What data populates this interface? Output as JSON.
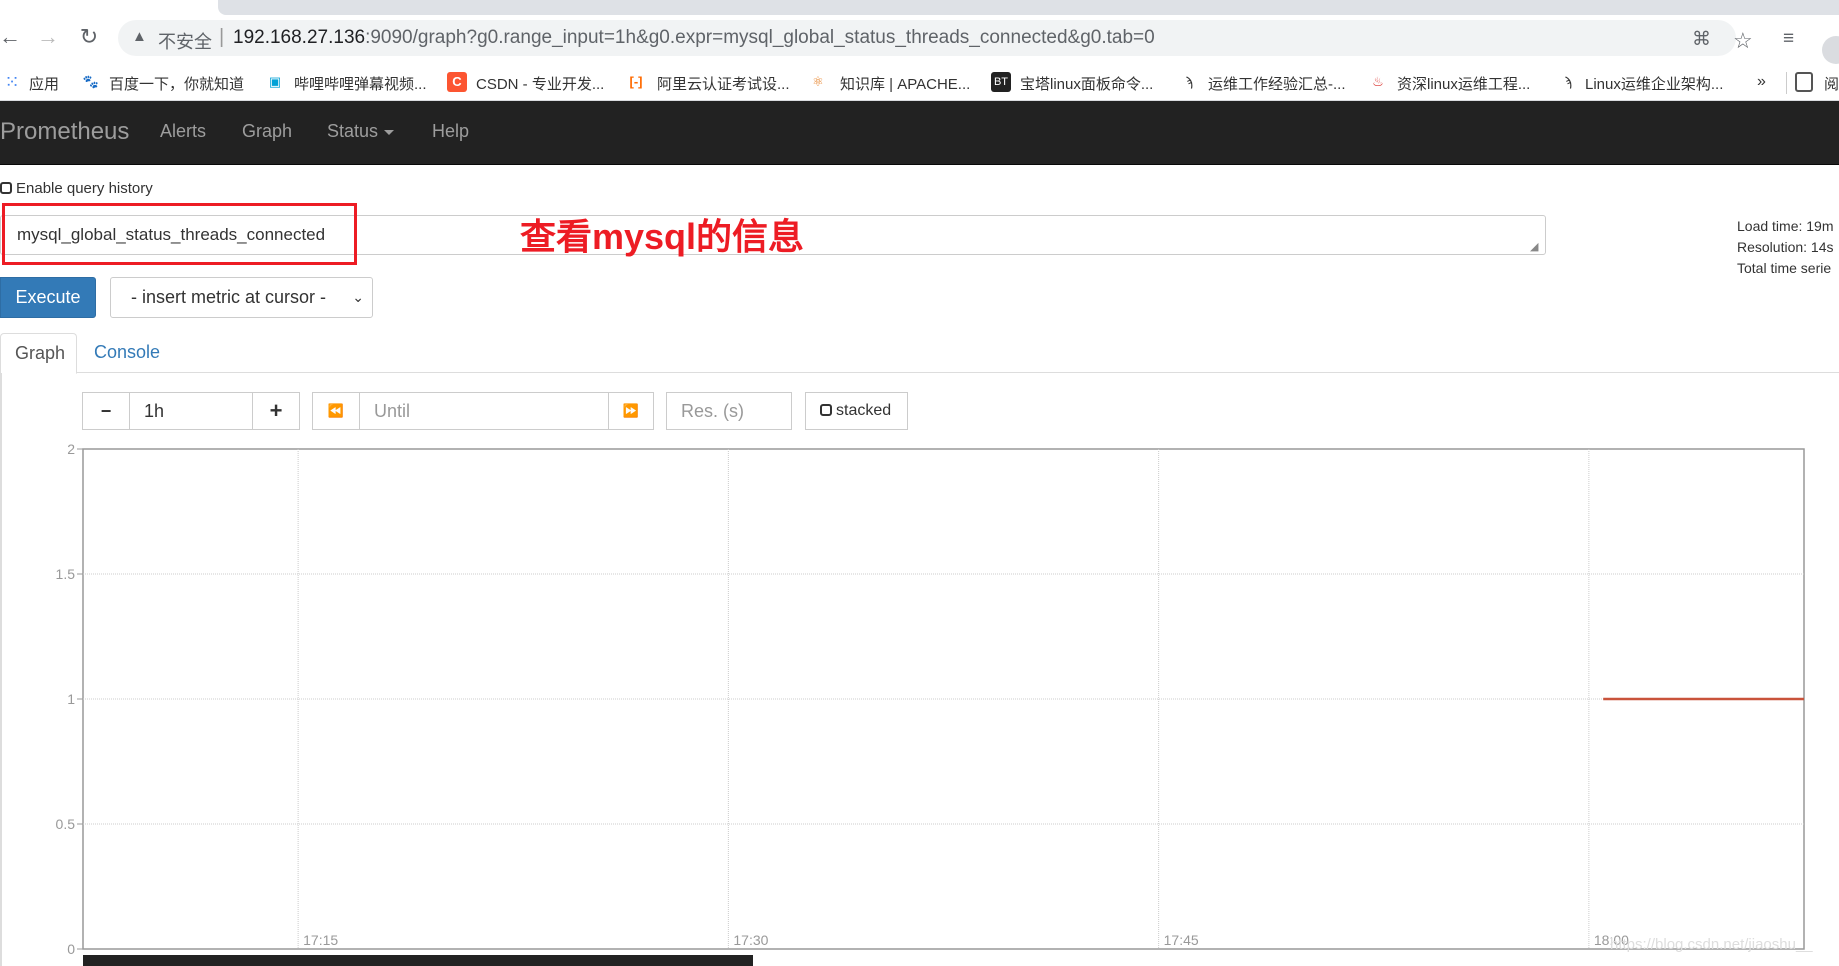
{
  "browser": {
    "insecure_label": "不安全",
    "url_host": "192.168.27.136",
    "url_rest": ":9090/graph?g0.range_input=1h&g0.expr=mysql_global_status_threads_connected&g0.tab=0",
    "bookmarks": [
      {
        "label": "应用",
        "icon": "apps-grid-icon"
      },
      {
        "label": "百度一下，你就知道",
        "icon": "baidu-paw-icon"
      },
      {
        "label": "哔哩哔哩弹幕视频...",
        "icon": "bilibili-tv-icon"
      },
      {
        "label": "CSDN - 专业开发...",
        "icon": "csdn-c-icon"
      },
      {
        "label": "阿里云认证考试设...",
        "icon": "aliyun-icon"
      },
      {
        "label": "知识库 | APACHE...",
        "icon": "atom-icon"
      },
      {
        "label": "宝塔linux面板命令...",
        "icon": "bt-icon"
      },
      {
        "label": "运维工作经验汇总-...",
        "icon": "bird-icon"
      },
      {
        "label": "资深linux运维工程...",
        "icon": "flame-icon"
      },
      {
        "label": "Linux运维企业架构...",
        "icon": "bird-icon"
      }
    ],
    "more_label": "»",
    "reading_list_label": "阅"
  },
  "navbar": {
    "brand": "Prometheus",
    "items": [
      "Alerts",
      "Graph",
      "Status",
      "Help"
    ]
  },
  "query": {
    "history_label": "Enable query history",
    "history_checked": false,
    "expression": "mysql_global_status_threads_connected",
    "annotation": "查看mysql的信息",
    "annotation_color": "#ed1c24",
    "execute_label": "Execute",
    "metric_select": "- insert metric at cursor -",
    "info": [
      "Load time: 19m",
      "Resolution: 14s",
      "Total time serie"
    ]
  },
  "tabs": [
    {
      "label": "Graph",
      "active": true
    },
    {
      "label": "Console",
      "active": false
    }
  ],
  "controls": {
    "minus": "−",
    "range": "1h",
    "plus": "+",
    "back": "⏪",
    "until_placeholder": "Until",
    "forward": "⏩",
    "res_placeholder": "Res. (s)",
    "stacked_label": "stacked",
    "stacked_checked": false
  },
  "watermark": "https://blog.csdn.net/jiaoshu__",
  "chart_data": {
    "type": "line",
    "title": "",
    "xlabel": "",
    "ylabel": "",
    "x_range": [
      "17:07:30",
      "18:07:30"
    ],
    "ylim": [
      0,
      2
    ],
    "yticks": [
      "0",
      "0.5",
      "1",
      "1.5",
      "2"
    ],
    "xticks": [
      "17:15",
      "17:30",
      "17:45",
      "18:00"
    ],
    "grid": true,
    "series": [
      {
        "color": "#c9533b",
        "x": [
          "18:00:30",
          "18:07:30"
        ],
        "values": [
          1,
          1
        ]
      }
    ]
  }
}
